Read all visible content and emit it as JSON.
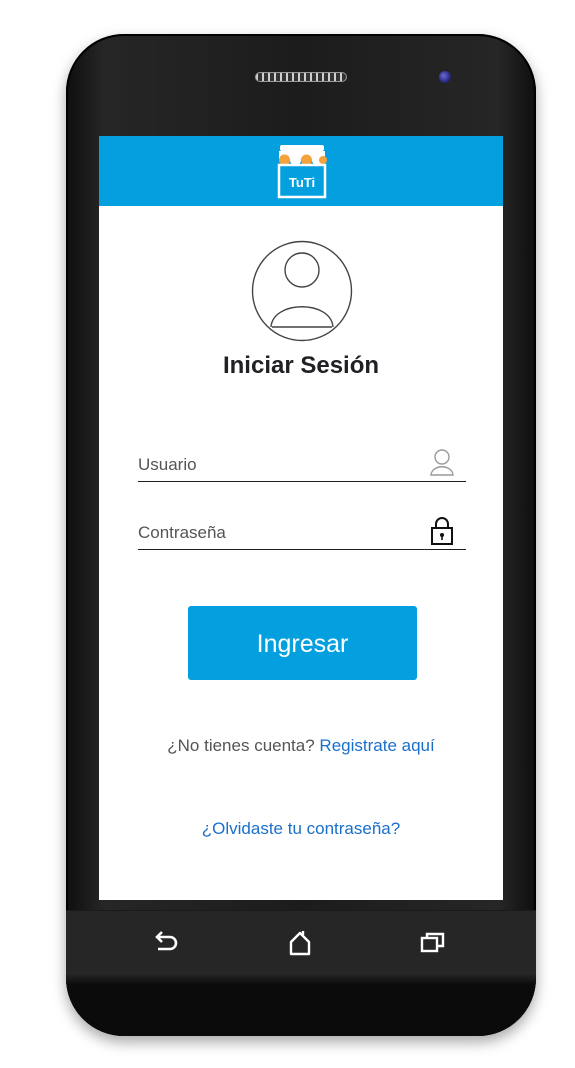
{
  "app": {
    "logo_text": "TuTi",
    "brand_color": "#049fde"
  },
  "login": {
    "title": "Iniciar Sesión",
    "username": {
      "placeholder": "Usuario",
      "value": "",
      "icon": "user-outline-icon"
    },
    "password": {
      "placeholder": "Contraseña",
      "value": "",
      "icon": "lock-icon"
    },
    "submit_label": "Ingresar",
    "register_prompt": "¿No tienes cuenta?",
    "register_link": "Registrate aquí",
    "forgot_link": "¿Olvidaste tu contraseña?",
    "link_color": "#1a6fcc"
  },
  "navbar": {
    "back_icon": "back-icon",
    "home_icon": "home-icon",
    "recent_icon": "recent-apps-icon"
  }
}
